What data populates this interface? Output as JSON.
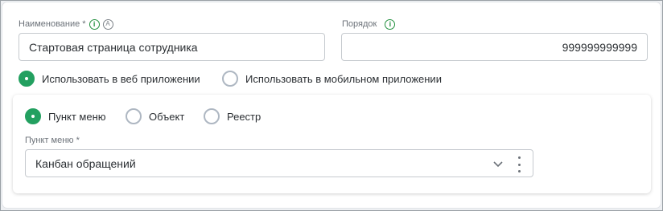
{
  "form": {
    "name": {
      "label": "Наименование *",
      "value": "Стартовая страница сотрудника",
      "info_icon": "info-icon",
      "lang_icon": "A"
    },
    "order": {
      "label": "Порядок",
      "value": "999999999999",
      "info_icon": "info-icon"
    },
    "platform": {
      "options": [
        {
          "label": "Использовать в веб приложении",
          "checked": true
        },
        {
          "label": "Использовать в мобильном приложении",
          "checked": false
        }
      ]
    },
    "target": {
      "options": [
        {
          "label": "Пункт меню",
          "checked": true
        },
        {
          "label": "Объект",
          "checked": false
        },
        {
          "label": "Реестр",
          "checked": false
        }
      ],
      "menu_item": {
        "label": "Пункт меню *",
        "value": "Канбан обращений"
      }
    }
  },
  "colors": {
    "accent": "#23a060",
    "info_green": "#23903f",
    "border": "#c6cacf"
  }
}
